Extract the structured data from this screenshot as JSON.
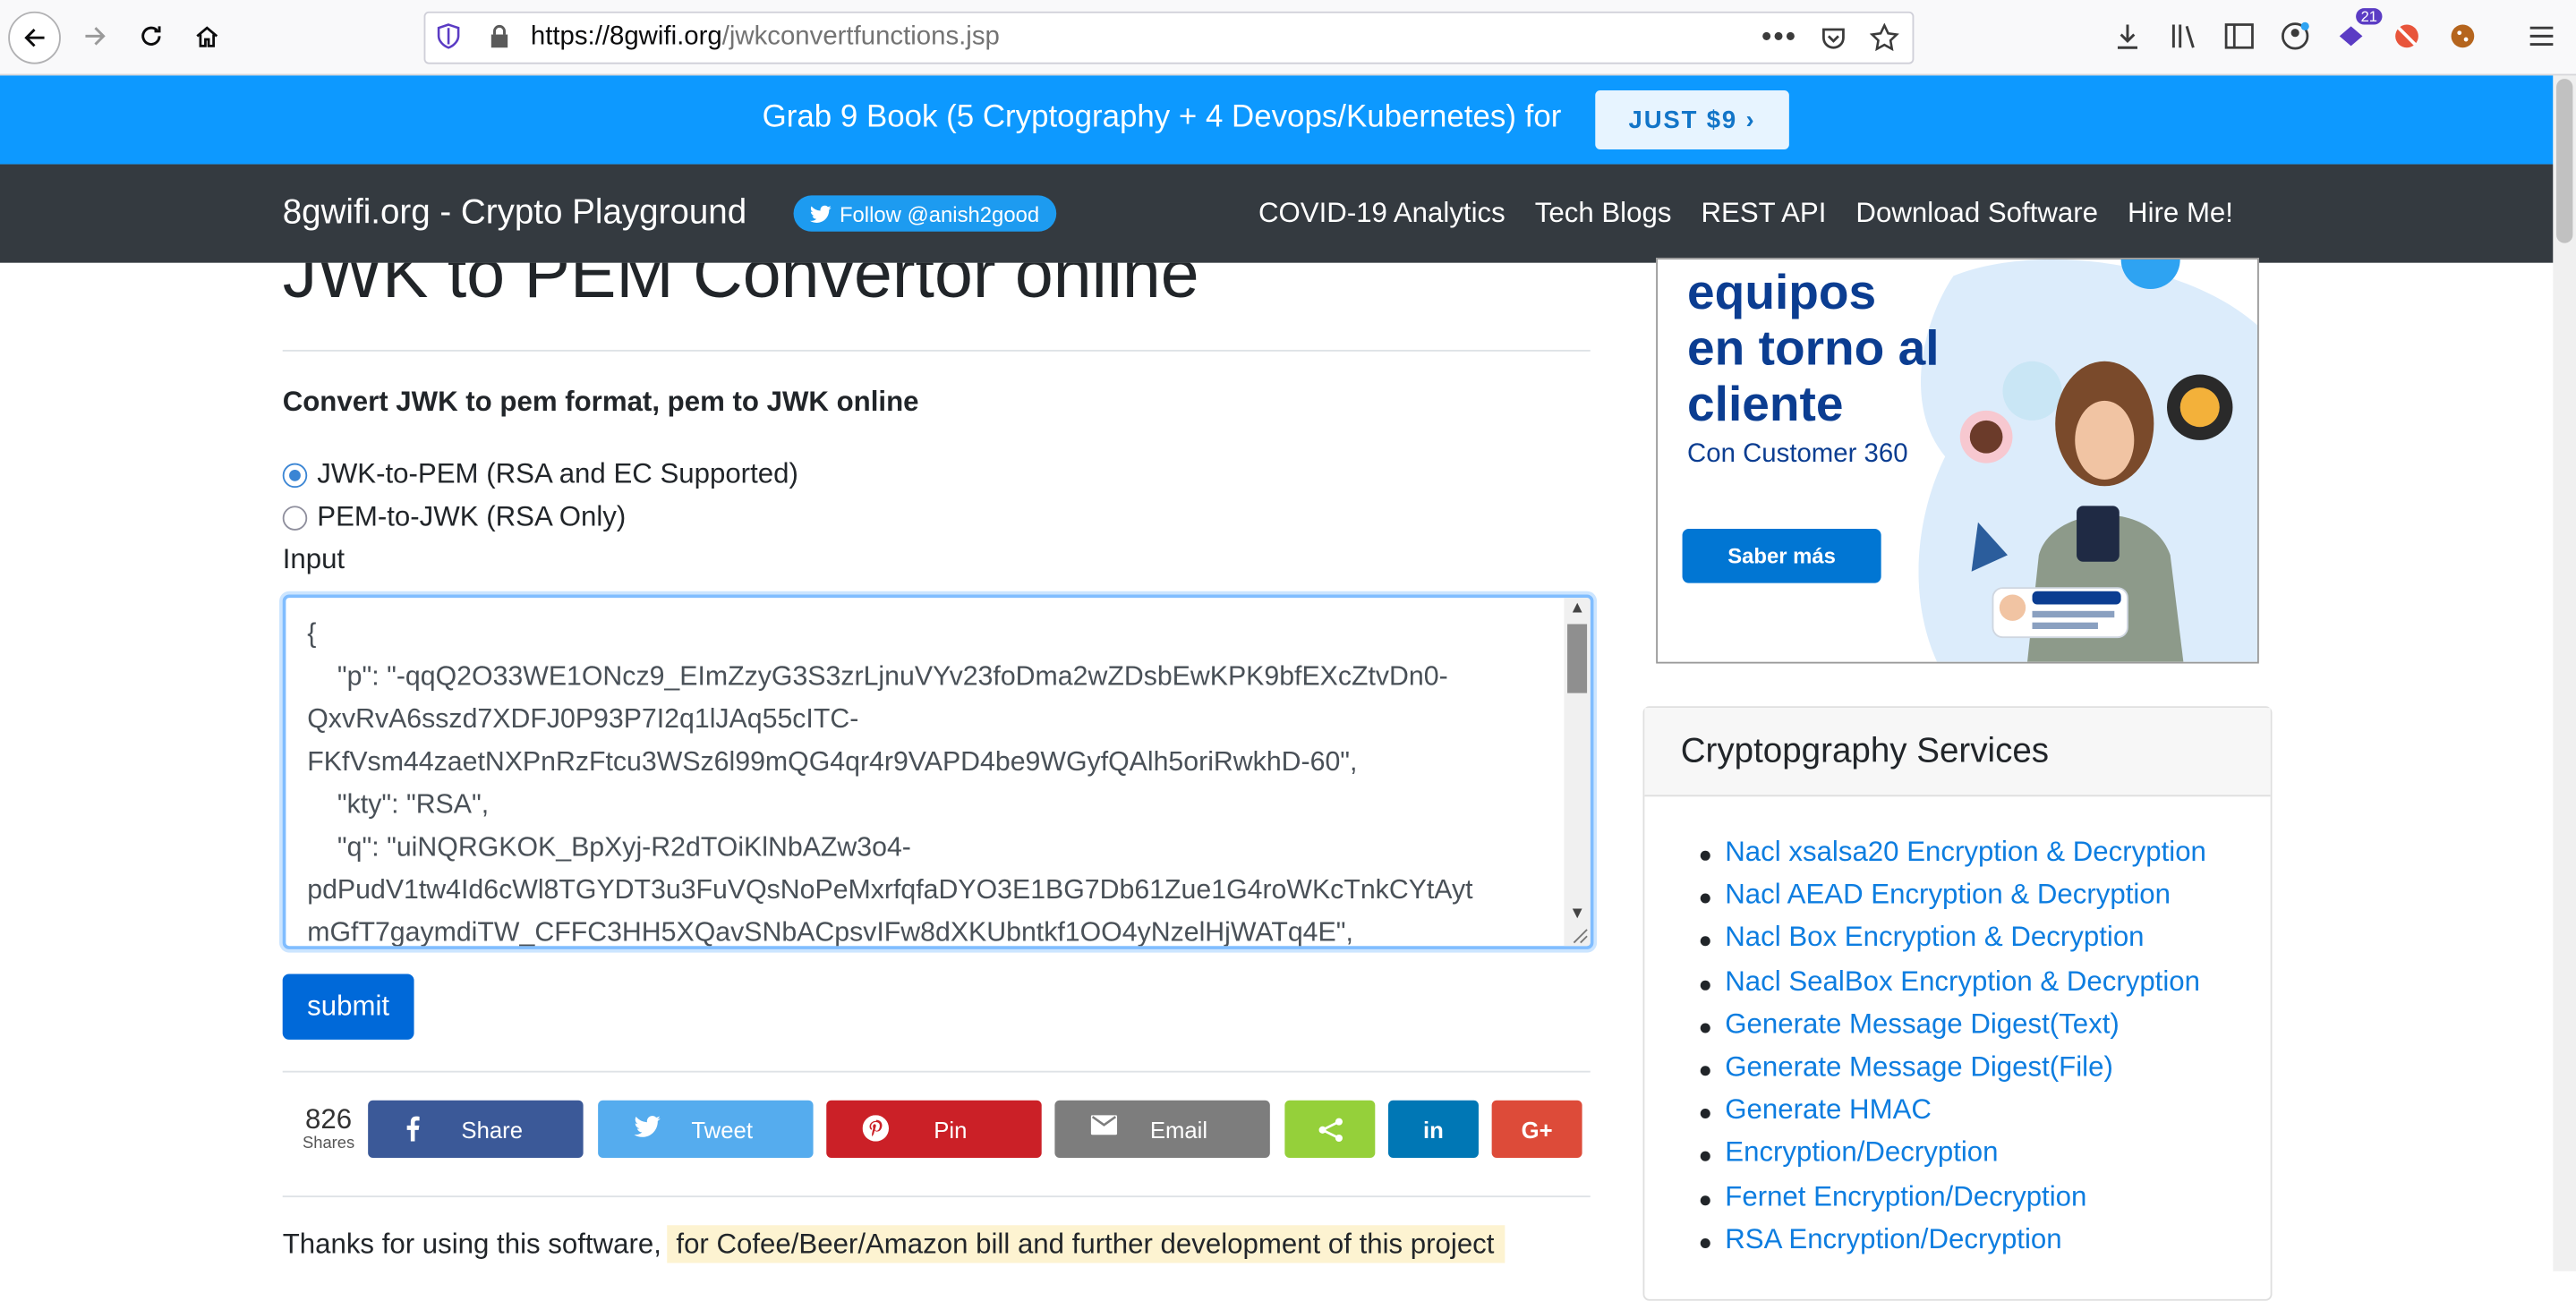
{
  "browser": {
    "url_domain": "https://8gwifi.org",
    "url_path": "/jwkconvertfunctions.jsp",
    "extension_badge": "21"
  },
  "promo": {
    "text": "Grab 9 Book (5 Cryptography + 4 Devops/Kubernetes) for",
    "button": "JUST $9 ›",
    "color": "#0d99ff"
  },
  "navbar": {
    "brand": "8gwifi.org - Crypto Playground",
    "follow": "Follow @anish2good",
    "links": [
      "COVID-19 Analytics",
      "Tech Blogs",
      "REST API",
      "Download Software",
      "Hire Me!"
    ]
  },
  "main": {
    "title": "JWK to PEM Convertor online",
    "subheading": "Convert JWK to pem format, pem to JWK online",
    "options": [
      {
        "label": "JWK-to-PEM (RSA and EC Supported)",
        "checked": true
      },
      {
        "label": "PEM-to-JWK (RSA Only)",
        "checked": false
      }
    ],
    "input_label": "Input",
    "input_lines": [
      "{",
      "    \"p\": \"-qqQ2O33WE1ONcz9_EImZzyG3S3zrLjnuVYv23foDma2wZDsbEwKPK9bfEXcZtvDn0-",
      "QxvRvA6sszd7XDFJ0P93P7I2q1lJAq55cITC-",
      "FKfVsm44zaetNXPnRzFtcu3WSz6l99mQG4qr4r9VAPD4be9WGyfQAlh5oriRwkhD-60\",",
      "    \"kty\": \"RSA\",",
      "    \"q\": \"uiNQRGKOK_BpXyj-R2dTOiKlNbAZw3o4-",
      "pdPudV1tw4Id6cWl8TGYDT3u3FuVQsNoPeMxrfqfaDYO3E1BG7Db61Zue1G4roWKcTnkCYtAyt",
      "mGfT7gaymdiTW_CFFC3HH5XQavSNbACpsvIFw8dXKUbntkf1OO4yNzelHjWATq4E\","
    ],
    "submit": "submit",
    "share_count": "826",
    "share_count_label": "Shares",
    "share_buttons": [
      {
        "label": "Share",
        "icon": "facebook-icon",
        "color": "#3b5998"
      },
      {
        "label": "Tweet",
        "icon": "twitter-icon",
        "color": "#55acee"
      },
      {
        "label": "Pin",
        "icon": "pinterest-icon",
        "color": "#cb2027"
      },
      {
        "label": "Email",
        "icon": "email-icon",
        "color": "#7d7d7d"
      },
      {
        "label": "",
        "icon": "sharethis-icon",
        "color": "#95d03a"
      },
      {
        "label": "",
        "icon": "linkedin-icon",
        "color": "#0077b5"
      },
      {
        "label": "",
        "icon": "googleplus-icon",
        "color": "#dd4b39"
      }
    ],
    "thanks": "Thanks for using this software,",
    "thanks_highlight": "for Cofee/Beer/Amazon bill and further development of this project"
  },
  "ad": {
    "line1": "equipos",
    "line2": "en torno al",
    "line3": "cliente",
    "subline": "Con Customer 360",
    "button": "Saber más"
  },
  "sidebar": {
    "title": "Cryptopgraphy Services",
    "items": [
      "Nacl xsalsa20 Encryption & Decryption",
      "Nacl AEAD Encryption & Decryption",
      "Nacl Box Encryption & Decryption",
      "Nacl SealBox Encryption & Decryption",
      "Generate Message Digest(Text)",
      "Generate Message Digest(File)",
      "Generate HMAC",
      "Encryption/Decryption",
      "Fernet Encryption/Decryption",
      "RSA Encryption/Decryption"
    ]
  }
}
